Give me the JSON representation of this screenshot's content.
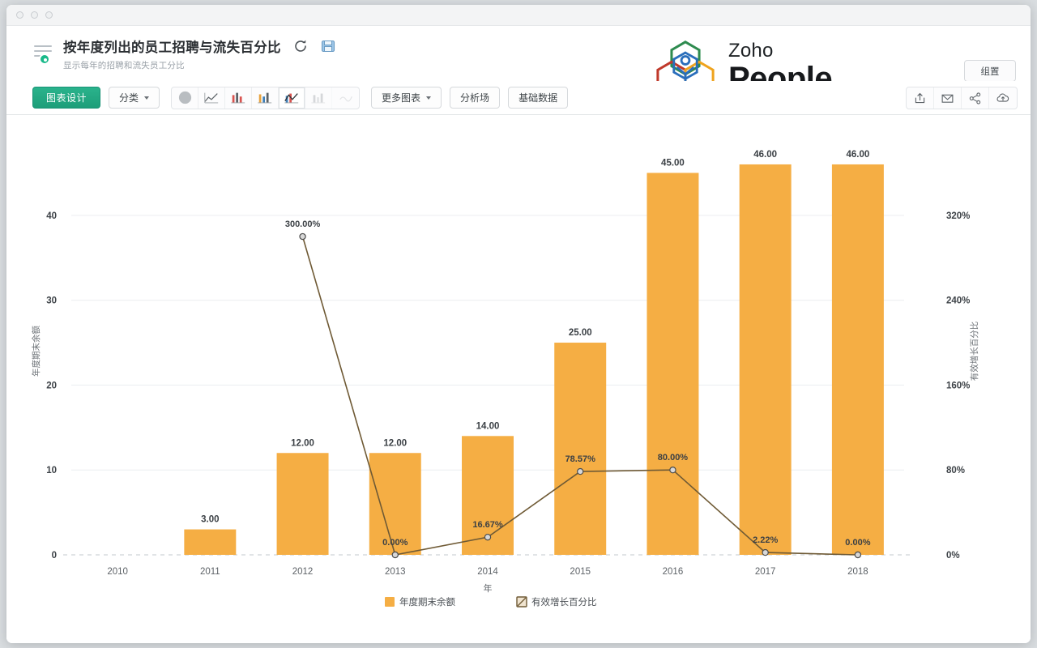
{
  "window": {
    "dots": 3
  },
  "header": {
    "title": "按年度列出的员工招聘与流失百分比",
    "subtitle": "显示每年的招聘和流失员工分比",
    "refresh_icon": "refresh-icon",
    "save_icon": "save-icon",
    "settings_label": "组置"
  },
  "brand": {
    "name_top": "Zoho",
    "name_bottom": "People",
    "colors": {
      "green": "#2e8b4f",
      "blue": "#2a6ebb",
      "red": "#c0392b",
      "yellow": "#efa31d"
    }
  },
  "toolbar": {
    "design_label": "图表设计",
    "category_label": "分类",
    "more_charts_label": "更多图表",
    "analysis_label": "分析场",
    "base_data_label": "基础数据",
    "chart_types": [
      {
        "name": "pie-chart-icon",
        "active": false,
        "disabled": false
      },
      {
        "name": "line-chart-icon",
        "active": false,
        "disabled": false
      },
      {
        "name": "bar-chart-icon",
        "active": false,
        "disabled": false
      },
      {
        "name": "column-chart-icon",
        "active": false,
        "disabled": false
      },
      {
        "name": "combo-chart-icon",
        "active": true,
        "disabled": false
      },
      {
        "name": "area-chart-icon",
        "active": false,
        "disabled": true
      },
      {
        "name": "scatter-chart-icon",
        "active": false,
        "disabled": true
      }
    ],
    "actions": [
      {
        "name": "export-icon"
      },
      {
        "name": "email-icon"
      },
      {
        "name": "share-icon"
      },
      {
        "name": "cloud-upload-icon"
      }
    ]
  },
  "chart_data": {
    "type": "bar",
    "title": "按年度列出的员工招聘与流失百分比",
    "xlabel": "年",
    "ylabel": "年度期末余额",
    "y2label": "有效增长百分比",
    "categories": [
      "2010",
      "2011",
      "2012",
      "2013",
      "2014",
      "2015",
      "2016",
      "2017",
      "2018"
    ],
    "series": [
      {
        "name": "年度期末余额",
        "type": "bar",
        "color": "#f5ae44",
        "axis": "left",
        "values": [
          0,
          3,
          12,
          12,
          14,
          25,
          45,
          46,
          46
        ],
        "labels": [
          "",
          "3.00",
          "12.00",
          "12.00",
          "14.00",
          "25.00",
          "45.00",
          "46.00",
          "46.00"
        ]
      },
      {
        "name": "有效增长百分比",
        "type": "line",
        "color": "#8a6a2f",
        "axis": "right",
        "values": [
          null,
          null,
          300.0,
          0.0,
          16.67,
          78.57,
          80.0,
          2.22,
          0.0
        ],
        "labels": [
          "",
          "",
          "300.00%",
          "0.00%",
          "16.67%",
          "78.57%",
          "80.00%",
          "2.22%",
          "0.00%"
        ]
      }
    ],
    "yticks": [
      "0",
      "10",
      "20",
      "30",
      "40"
    ],
    "ylim": [
      0,
      48
    ],
    "y2ticks": [
      "0%",
      "80%",
      "160%",
      "240%",
      "320%"
    ],
    "y2lim": [
      0,
      384
    ],
    "grid": true,
    "legend_position": "bottom",
    "legend": [
      {
        "label": "年度期末余额",
        "color": "#f5ae44",
        "marker": "square"
      },
      {
        "label": "有效增长百分比",
        "color": "#6f5a35",
        "marker": "square-line"
      }
    ]
  }
}
